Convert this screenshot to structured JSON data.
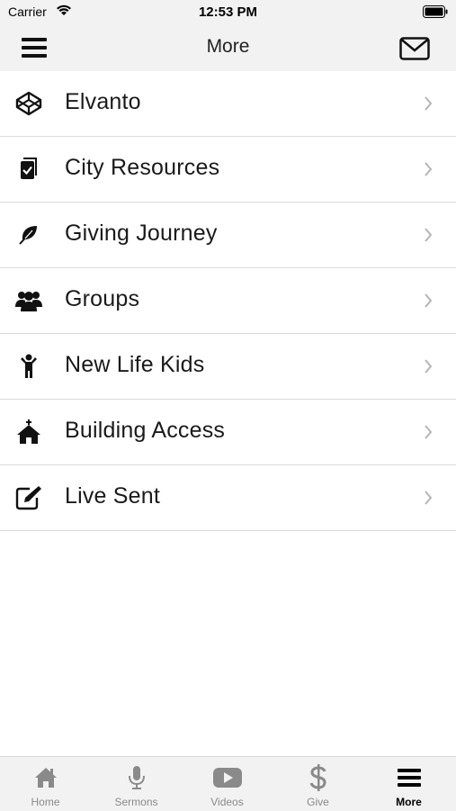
{
  "status": {
    "carrier": "Carrier",
    "time": "12:53 PM"
  },
  "nav": {
    "title": "More",
    "menu_icon": "hamburger-icon",
    "mail_icon": "envelope-icon"
  },
  "items": [
    {
      "label": "Elvanto",
      "icon": "codepen-cube-icon"
    },
    {
      "label": "City Resources",
      "icon": "clipboard-check-icon"
    },
    {
      "label": "Giving Journey",
      "icon": "leaf-icon"
    },
    {
      "label": "Groups",
      "icon": "users-group-icon"
    },
    {
      "label": "New Life Kids",
      "icon": "child-icon"
    },
    {
      "label": "Building Access",
      "icon": "church-icon"
    },
    {
      "label": "Live Sent",
      "icon": "edit-pencil-icon"
    }
  ],
  "tabs": [
    {
      "label": "Home",
      "icon": "home-icon",
      "active": false
    },
    {
      "label": "Sermons",
      "icon": "microphone-icon",
      "active": false
    },
    {
      "label": "Videos",
      "icon": "youtube-play-icon",
      "active": false
    },
    {
      "label": "Give",
      "icon": "dollar-icon",
      "active": false
    },
    {
      "label": "More",
      "icon": "hamburger-icon",
      "active": true
    }
  ],
  "colors": {
    "bar_bg": "#f2f2f2",
    "tab_inactive": "#8a8a8a",
    "tab_active": "#000000",
    "divider": "#dcdcdc"
  }
}
